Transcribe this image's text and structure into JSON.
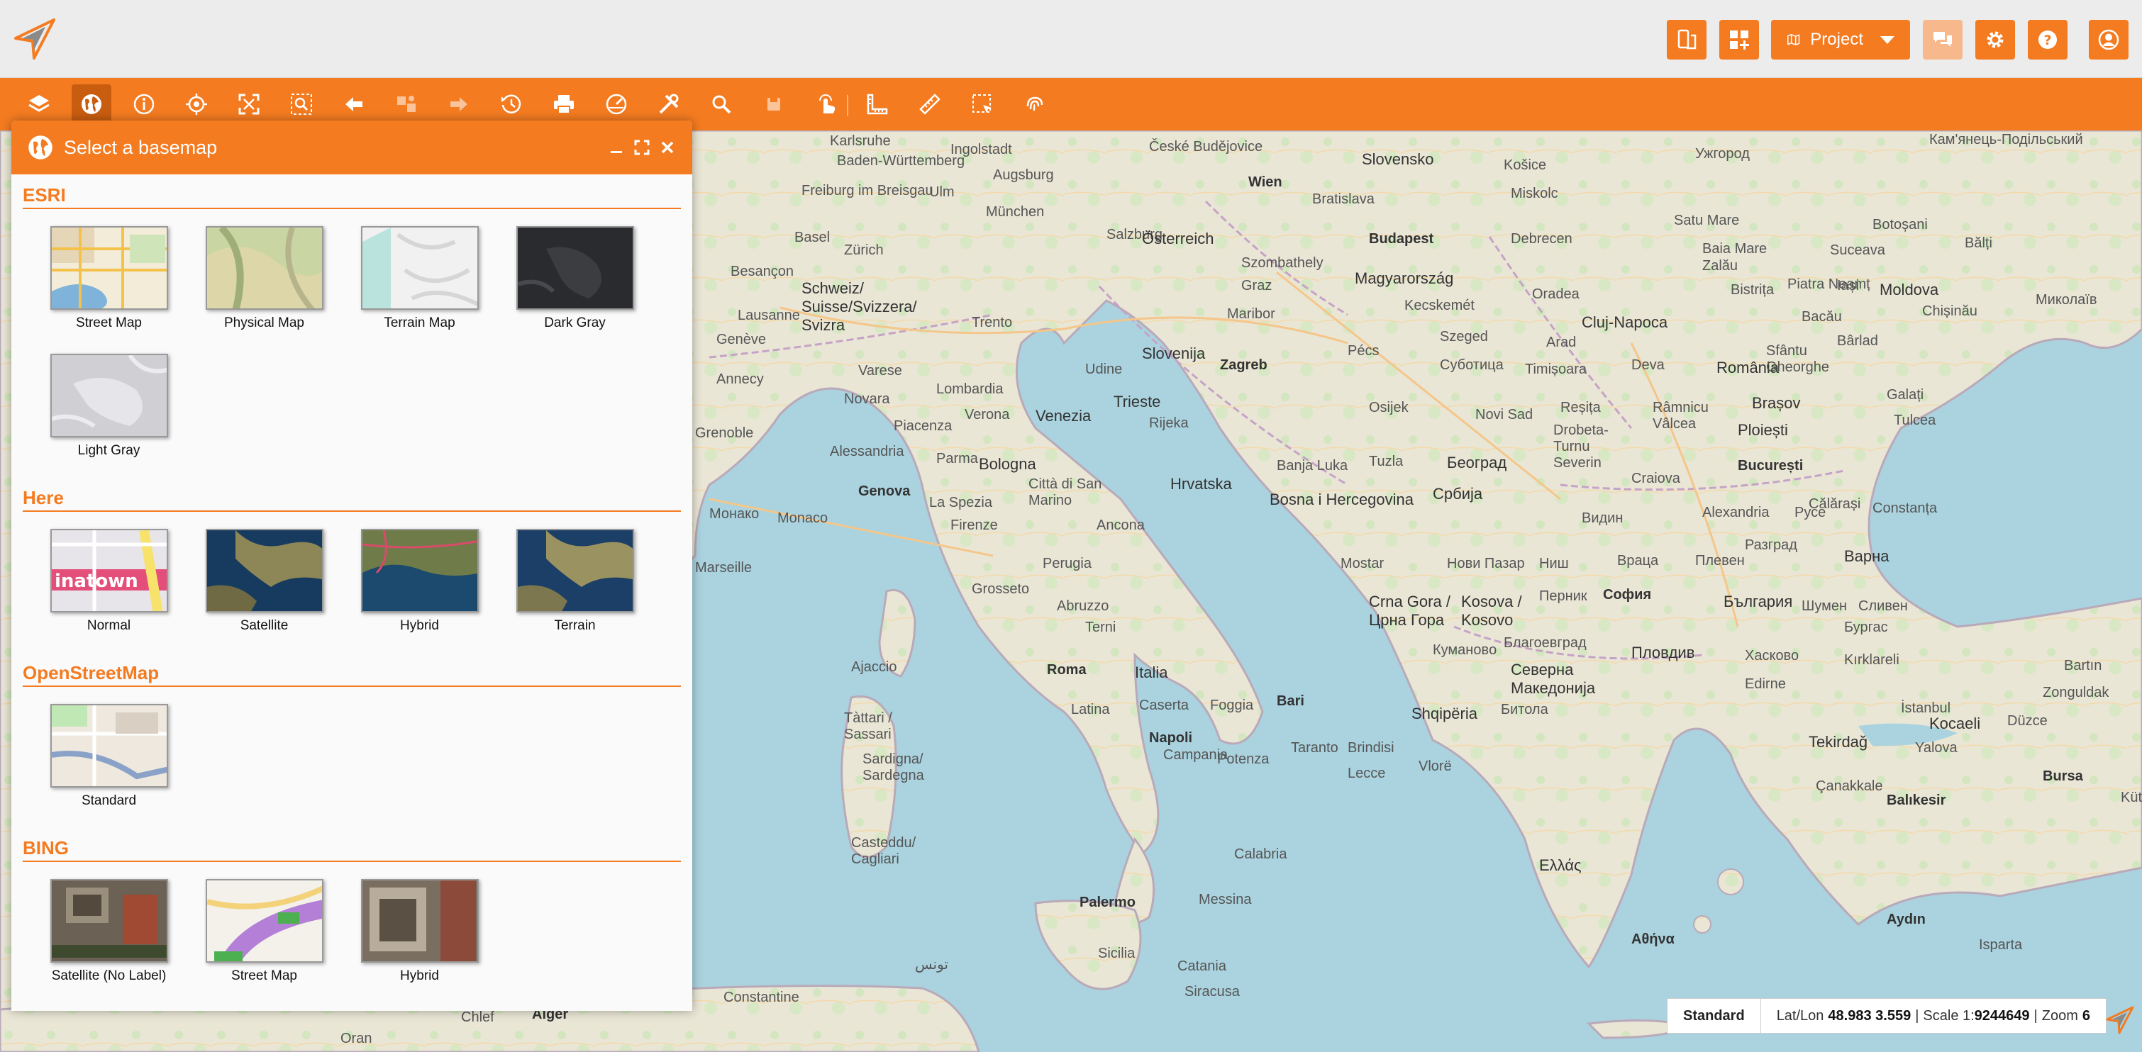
{
  "header": {
    "project_label": "Project",
    "buttons": [
      {
        "icon": "tablet-swap-icon"
      },
      {
        "icon": "dashboard-add-icon"
      },
      {
        "icon": "map-icon"
      },
      {
        "icon": "chat-icon"
      },
      {
        "icon": "gear-icon"
      },
      {
        "icon": "help-icon"
      },
      {
        "icon": "user-icon"
      }
    ]
  },
  "toolbar": {
    "tools": [
      "layers-icon",
      "globe-icon",
      "info-icon",
      "locate-icon",
      "full-extent-icon",
      "zoom-box-icon",
      "back-icon",
      "pan-icon",
      "forward-icon",
      "history-icon",
      "print-icon",
      "speed-icon",
      "tools-icon",
      "search-icon",
      "save-icon",
      "touch-icon",
      "measure-corner-icon",
      "ruler-icon",
      "select-area-icon",
      "fingerprint-icon"
    ]
  },
  "panel": {
    "title": "Select a basemap",
    "groups": [
      {
        "title": "ESRI",
        "items": [
          {
            "label": "Street Map"
          },
          {
            "label": "Physical Map"
          },
          {
            "label": "Terrain Map"
          },
          {
            "label": "Dark Gray"
          },
          {
            "label": "Light Gray"
          }
        ]
      },
      {
        "title": "Here",
        "items": [
          {
            "label": "Normal"
          },
          {
            "label": "Satellite"
          },
          {
            "label": "Hybrid"
          },
          {
            "label": "Terrain"
          }
        ]
      },
      {
        "title": "OpenStreetMap",
        "items": [
          {
            "label": "Standard"
          }
        ]
      },
      {
        "title": "BING",
        "items": [
          {
            "label": "Satellite (No Label)"
          },
          {
            "label": "Street Map"
          },
          {
            "label": "Hybrid"
          }
        ]
      }
    ]
  },
  "map": {
    "labels": [
      {
        "t": "Karlsruhe"
      },
      {
        "t": "Ingolstadt"
      },
      {
        "t": "České Budějovice"
      },
      {
        "t": "Slovensko"
      },
      {
        "t": "Košice"
      },
      {
        "t": "Ужгород"
      },
      {
        "t": "Кам'янець-Подільський"
      },
      {
        "t": "Baden-Württemberg"
      },
      {
        "t": "Augsburg"
      },
      {
        "t": "Wien"
      },
      {
        "t": "Bratislava"
      },
      {
        "t": "Miskolc"
      },
      {
        "t": "Freiburg im Breisgau"
      },
      {
        "t": "Ulm"
      },
      {
        "t": "München"
      },
      {
        "t": "Salzburg"
      },
      {
        "t": "Österreich"
      },
      {
        "t": "Budapest"
      },
      {
        "t": "Debrecen"
      },
      {
        "t": "Satu Mare"
      },
      {
        "t": "Botoșani"
      },
      {
        "t": "Basel"
      },
      {
        "t": "Zürich"
      },
      {
        "t": "Magyarország"
      },
      {
        "t": "Baia Mare"
      },
      {
        "t": "Suceava"
      },
      {
        "t": "Bălți"
      },
      {
        "t": "Besançon"
      },
      {
        "t": "Schweiz/ Suisse/Svizzera/ Svizra"
      },
      {
        "t": "Szombathely"
      },
      {
        "t": "Zalău"
      },
      {
        "t": "Iași"
      },
      {
        "t": "Moldova"
      },
      {
        "t": "Lausanne"
      },
      {
        "t": "Graz"
      },
      {
        "t": "Oradea"
      },
      {
        "t": "Bistrița"
      },
      {
        "t": "Piatra Neamț"
      },
      {
        "t": "Chișinău"
      },
      {
        "t": "Миколаїв"
      },
      {
        "t": "Genève"
      },
      {
        "t": "Trento"
      },
      {
        "t": "Maribor"
      },
      {
        "t": "Kecskemét"
      },
      {
        "t": "Cluj-Napoca"
      },
      {
        "t": "Bacău"
      },
      {
        "t": "Slovenija"
      },
      {
        "t": "Zagreb"
      },
      {
        "t": "Szeged"
      },
      {
        "t": "Arad"
      },
      {
        "t": "România"
      },
      {
        "t": "Bârlad"
      },
      {
        "t": "Udine"
      },
      {
        "t": "Pécs"
      },
      {
        "t": "Суботица"
      },
      {
        "t": "Timișoara"
      },
      {
        "t": "Deva"
      },
      {
        "t": "Sfântu Gheorghe"
      },
      {
        "t": "Galați"
      },
      {
        "t": "Annecy"
      },
      {
        "t": "Varese"
      },
      {
        "t": "Lombardia"
      },
      {
        "t": "Venezia"
      },
      {
        "t": "Trieste"
      },
      {
        "t": "Osijek"
      },
      {
        "t": "Novi Sad"
      },
      {
        "t": "Brașov"
      },
      {
        "t": "Tulcea"
      },
      {
        "t": "Grenoble"
      },
      {
        "t": "Novara"
      },
      {
        "t": "Verona"
      },
      {
        "t": "Rijeka"
      },
      {
        "t": "Reșița"
      },
      {
        "t": "Râmnicu Vâlcea"
      },
      {
        "t": "Ploiești"
      },
      {
        "t": "Piacenza"
      },
      {
        "t": "Alessandria"
      },
      {
        "t": "Parma"
      },
      {
        "t": "Bologna"
      },
      {
        "t": "Hrvatska"
      },
      {
        "t": "Banja Luka"
      },
      {
        "t": "Tuzla"
      },
      {
        "t": "Београд"
      },
      {
        "t": "Drobeta-Turnu Severin"
      },
      {
        "t": "Craiova"
      },
      {
        "t": "București"
      },
      {
        "t": "Constanța"
      },
      {
        "t": "Genova"
      },
      {
        "t": "Città di San Marino"
      },
      {
        "t": "Bosna i Hercegovina"
      },
      {
        "t": "Србија"
      },
      {
        "t": "Монако"
      },
      {
        "t": "Monaco"
      },
      {
        "t": "La Spezia"
      },
      {
        "t": "Ancona"
      },
      {
        "t": "Firenze"
      },
      {
        "t": "Видин"
      },
      {
        "t": "Alexandria"
      },
      {
        "t": "Русе"
      },
      {
        "t": "Călărași"
      },
      {
        "t": "Perugia"
      },
      {
        "t": "Mostar"
      },
      {
        "t": "Нови Пазар"
      },
      {
        "t": "Ниш"
      },
      {
        "t": "Враца"
      },
      {
        "t": "Плевен"
      },
      {
        "t": "Разград"
      },
      {
        "t": "Варна"
      },
      {
        "t": "Grosseto"
      },
      {
        "t": "Crna Gora / Црна Гора"
      },
      {
        "t": "Kosova / Kosovo"
      },
      {
        "t": "Перник"
      },
      {
        "t": "София"
      },
      {
        "t": "България"
      },
      {
        "t": "Шумен"
      },
      {
        "t": "Сливен"
      },
      {
        "t": "Terni"
      },
      {
        "t": "Abruzzo"
      },
      {
        "t": "Бургас"
      },
      {
        "t": "Ajaccio"
      },
      {
        "t": "Roma"
      },
      {
        "t": "Italia"
      },
      {
        "t": "Кумановo"
      },
      {
        "t": "Благоевград"
      },
      {
        "t": "Пловдив"
      },
      {
        "t": "Хасково"
      },
      {
        "t": "Kırklareli"
      },
      {
        "t": "Bartın"
      },
      {
        "t": "Bari"
      },
      {
        "t": "Shqipëria"
      },
      {
        "t": "Северна Македонија"
      },
      {
        "t": "Edirne"
      },
      {
        "t": "Zonguldak"
      },
      {
        "t": "Tàttari / Sassari"
      },
      {
        "t": "Latina"
      },
      {
        "t": "Caserta"
      },
      {
        "t": "Foggia"
      },
      {
        "t": "Битола"
      },
      {
        "t": "İstanbul"
      },
      {
        "t": "Kocaeli"
      },
      {
        "t": "Düzce"
      },
      {
        "t": "Napoli"
      },
      {
        "t": "Campania"
      },
      {
        "t": "Taranto"
      },
      {
        "t": "Brindisi"
      },
      {
        "t": "Tekirdağ"
      },
      {
        "t": "Yalova"
      },
      {
        "t": "Sardigna/ Sardegna"
      },
      {
        "t": "Potenza"
      },
      {
        "t": "Lecce"
      },
      {
        "t": "Vlorë"
      },
      {
        "t": "Bursa"
      },
      {
        "t": "Çanakkale"
      },
      {
        "t": "Balıkesir"
      },
      {
        "t": "Kütahya"
      },
      {
        "t": "Casteddu/ Cagliari"
      },
      {
        "t": "Calabria"
      },
      {
        "t": "Ελλάς"
      },
      {
        "t": "Palermo"
      },
      {
        "t": "Messina"
      },
      {
        "t": "Aydın"
      },
      {
        "t": "Sicilia"
      },
      {
        "t": "Catania"
      },
      {
        "t": "Αθήνα"
      },
      {
        "t": "Isparta"
      },
      {
        "t": "Siracusa"
      },
      {
        "t": "Constantine"
      },
      {
        "t": "تونس"
      },
      {
        "t": "Alger"
      },
      {
        "t": "Oran"
      },
      {
        "t": "Chlef"
      },
      {
        "t": "Marseille"
      }
    ]
  },
  "status": {
    "basemap": "Standard",
    "latlon_label": "Lat/Lon",
    "latlon_value": "48.983 3.559",
    "scale_label": "Scale 1:",
    "scale_value": "9244649",
    "zoom_label": "Zoom",
    "zoom_value": "6"
  }
}
